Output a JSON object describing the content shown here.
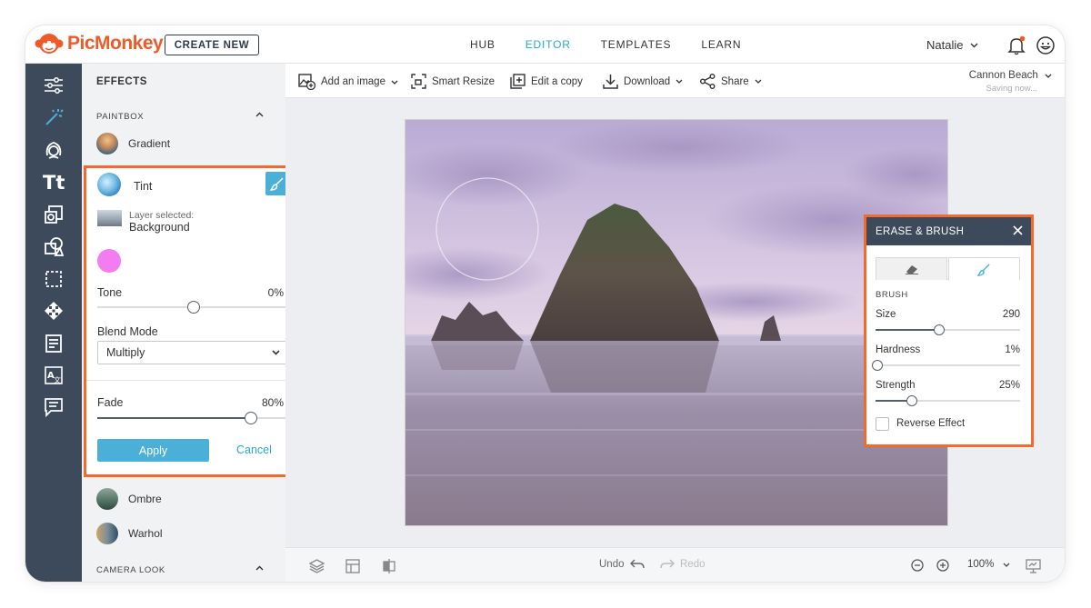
{
  "brand": {
    "logo_text": "PicMonkey",
    "accent": "#f05a28"
  },
  "header": {
    "create_new": "CREATE NEW",
    "nav": [
      "HUB",
      "EDITOR",
      "TEMPLATES",
      "LEARN"
    ],
    "active_nav": "EDITOR",
    "user": "Natalie"
  },
  "effects": {
    "title": "EFFECTS",
    "paintbox": "PAINTBOX",
    "camera_look": "CAMERA LOOK",
    "items_top": [
      "Gradient"
    ],
    "items_bottom": [
      "Ombre",
      "Warhol"
    ]
  },
  "tint": {
    "name": "Tint",
    "layer_label": "Layer selected:",
    "layer_value": "Background",
    "color": "#f27cf0",
    "tone_label": "Tone",
    "tone_value": "0%",
    "tone": 0.5,
    "blend_label": "Blend Mode",
    "blend_value": "Multiply",
    "fade_label": "Fade",
    "fade_value": "80%",
    "fade": 0.8,
    "apply": "Apply",
    "cancel": "Cancel"
  },
  "toolbar": {
    "add_image": "Add an image",
    "smart_resize": "Smart Resize",
    "edit_copy": "Edit a copy",
    "download": "Download",
    "share": "Share",
    "project": "Cannon Beach",
    "saving": "Saving now..."
  },
  "erase_brush": {
    "title": "ERASE & BRUSH",
    "section": "BRUSH",
    "size_label": "Size",
    "size_value": "290",
    "size": 0.44,
    "hardness_label": "Hardness",
    "hardness_value": "1%",
    "hardness": 0.01,
    "strength_label": "Strength",
    "strength_value": "25%",
    "strength": 0.25,
    "reverse": "Reverse Effect"
  },
  "bottom": {
    "undo": "Undo",
    "redo": "Redo",
    "zoom": "100%"
  }
}
